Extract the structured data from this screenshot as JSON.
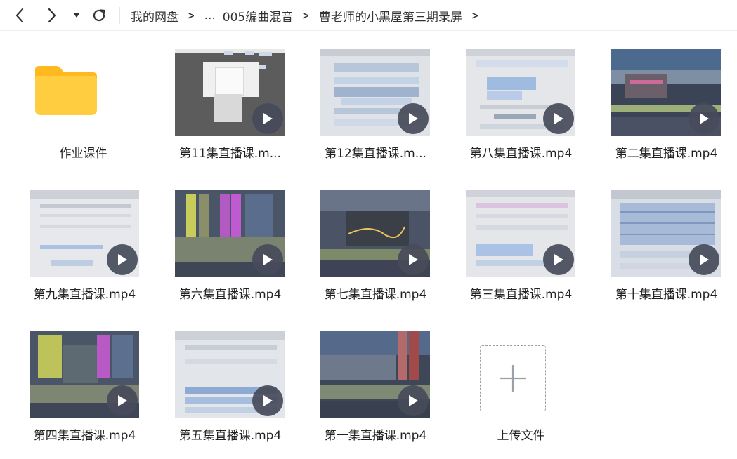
{
  "toolbar": {
    "back_icon": "chevron-left-icon",
    "forward_icon": "chevron-right-icon",
    "history_icon": "caret-down-icon",
    "refresh_icon": "refresh-icon"
  },
  "breadcrumb": {
    "root": "我的网盘",
    "ellipsis": "...",
    "items": [
      "005编曲混音",
      "曹老师的小黑屋第三期录屏"
    ],
    "separator": ">"
  },
  "files": [
    {
      "name": "作业课件",
      "type": "folder"
    },
    {
      "name": "第11集直播课.m...",
      "type": "video"
    },
    {
      "name": "第12集直播课.m...",
      "type": "video"
    },
    {
      "name": "第八集直播课.mp4",
      "type": "video"
    },
    {
      "name": "第二集直播课.mp4",
      "type": "video"
    },
    {
      "name": "第九集直播课.mp4",
      "type": "video"
    },
    {
      "name": "第六集直播课.mp4",
      "type": "video"
    },
    {
      "name": "第七集直播课.mp4",
      "type": "video"
    },
    {
      "name": "第三集直播课.mp4",
      "type": "video"
    },
    {
      "name": "第十集直播课.mp4",
      "type": "video"
    },
    {
      "name": "第四集直播课.mp4",
      "type": "video"
    },
    {
      "name": "第五集直播课.mp4",
      "type": "video"
    },
    {
      "name": "第一集直播课.mp4",
      "type": "video"
    }
  ],
  "upload": {
    "label": "上传文件",
    "icon": "plus-icon"
  },
  "colors": {
    "folder": "#FFC93C",
    "play_bg": "#464B5A",
    "upload_border": "#9AA0A8"
  }
}
